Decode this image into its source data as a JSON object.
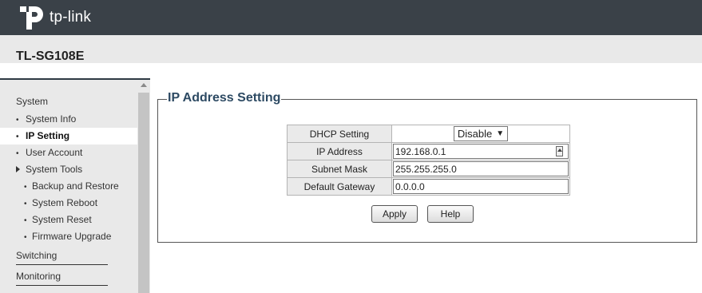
{
  "brand": {
    "logo_text": "tp-link"
  },
  "device": {
    "model": "TL-SG108E"
  },
  "sidebar": {
    "sections": [
      {
        "label": "System"
      },
      {
        "label": "Switching"
      },
      {
        "label": "Monitoring"
      }
    ],
    "items": [
      {
        "label": "System Info"
      },
      {
        "label": "IP Setting"
      },
      {
        "label": "User Account"
      },
      {
        "label": "System Tools"
      },
      {
        "label": "Backup and Restore"
      },
      {
        "label": "System Reboot"
      },
      {
        "label": "System Reset"
      },
      {
        "label": "Firmware Upgrade"
      }
    ],
    "active_item": "IP Setting"
  },
  "main": {
    "legend": "IP Address Setting",
    "rows": [
      {
        "label": "DHCP Setting",
        "value": "Disable"
      },
      {
        "label": "IP Address",
        "value": "192.168.0.1"
      },
      {
        "label": "Subnet Mask",
        "value": "255.255.255.0"
      },
      {
        "label": "Default Gateway",
        "value": "0.0.0.0"
      }
    ],
    "buttons": {
      "apply": "Apply",
      "help": "Help"
    }
  },
  "colors": {
    "topbar": "#3a4148",
    "legend_text": "#2d4a63",
    "sidebar_bg": "#e9e9e9"
  }
}
